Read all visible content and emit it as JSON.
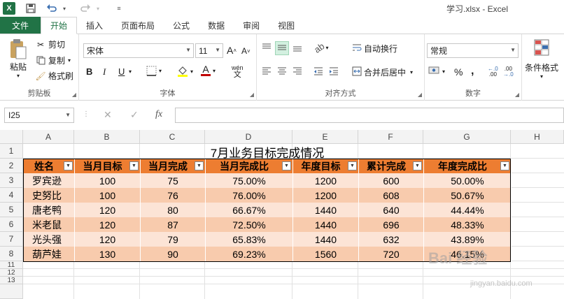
{
  "app": {
    "title": "学习.xlsx - Excel",
    "logo": "X"
  },
  "tabs": [
    "文件",
    "开始",
    "插入",
    "页面布局",
    "公式",
    "数据",
    "审阅",
    "视图"
  ],
  "ribbon": {
    "clipboard": {
      "label": "剪贴板",
      "paste": "粘贴",
      "cut": "剪切",
      "copy": "复制",
      "format_painter": "格式刷"
    },
    "font": {
      "label": "字体",
      "font_name": "宋体",
      "font_size": "11",
      "bold": "B",
      "italic": "I",
      "underline": "U",
      "grow": "A",
      "shrink": "A",
      "phonetic": "wén",
      "font_color_letter": "A"
    },
    "alignment": {
      "label": "对齐方式",
      "wrap_text": "自动换行",
      "merge_center": "合并后居中"
    },
    "number": {
      "label": "数字",
      "format": "常规",
      "percent": "%",
      "comma": ","
    },
    "styles": {
      "conditional": "条件格式"
    }
  },
  "formula_bar": {
    "name_box": "I25",
    "fx": "fx",
    "content": ""
  },
  "sheet": {
    "columns": [
      "A",
      "B",
      "C",
      "D",
      "E",
      "F",
      "G",
      "H"
    ],
    "rows": [
      "1",
      "2",
      "3",
      "4",
      "5",
      "6",
      "7",
      "8",
      "11",
      "12",
      "13"
    ],
    "title": "7月业务目标完成情况",
    "headers": [
      "姓名",
      "当月目标",
      "当月完成",
      "当月完成比",
      "年度目标",
      "累计完成",
      "年度完成比"
    ],
    "data": [
      [
        "罗宾逊",
        "100",
        "75",
        "75.00%",
        "1200",
        "600",
        "50.00%"
      ],
      [
        "史努比",
        "100",
        "76",
        "76.00%",
        "1200",
        "608",
        "50.67%"
      ],
      [
        "唐老鸭",
        "120",
        "80",
        "66.67%",
        "1440",
        "640",
        "44.44%"
      ],
      [
        "米老鼠",
        "120",
        "87",
        "72.50%",
        "1440",
        "696",
        "48.33%"
      ],
      [
        "光头强",
        "120",
        "79",
        "65.83%",
        "1440",
        "632",
        "43.89%"
      ],
      [
        "葫芦娃",
        "130",
        "90",
        "69.23%",
        "1560",
        "720",
        "46.15%"
      ]
    ]
  },
  "watermark": {
    "text": "Bai 经验",
    "url": "jingyan.baidu.com"
  },
  "colors": {
    "excel_green": "#217346",
    "header_orange": "#ed7d31",
    "row_odd": "#f8cbad",
    "row_even": "#fce4d6"
  }
}
